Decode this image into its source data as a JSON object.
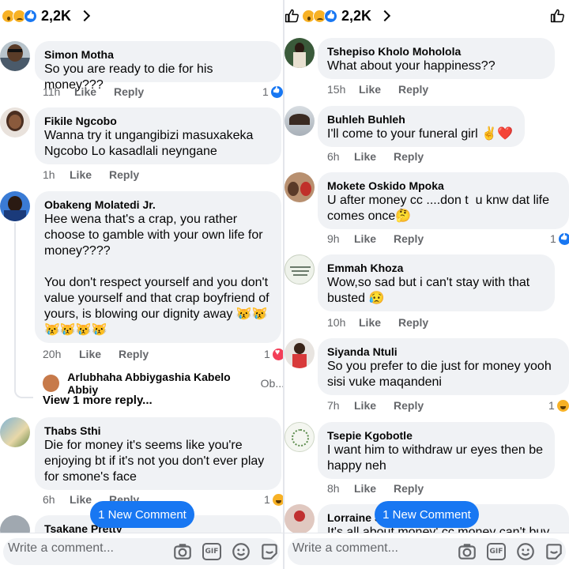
{
  "left": {
    "header": {
      "count": "2,2K"
    },
    "comments": [
      {
        "author": "Simon Motha",
        "text": "So you are ready to die for his money???",
        "time": "11h",
        "like": "Like",
        "reply": "Reply",
        "reaction_count": "1"
      },
      {
        "author": "Fikile Ngcobo",
        "text": "Wanna try it ungangibizi masuxakeka Ngcobo Lo kasadlali neyngane",
        "time": "1h",
        "like": "Like",
        "reply": "Reply"
      },
      {
        "author": "Obakeng Molatedi Jr.",
        "text": "Hee wena that's a crap, you rather choose to gamble with your own life for money????\n\nYou don't respect yourself and you don't value yourself and that crap boyfriend of yours, is blowing our dignity away 😿😿\n😿😿😿😿",
        "time": "20h",
        "like": "Like",
        "reply": "Reply",
        "reaction_count": "1"
      },
      {
        "author": "Thabs Sthi",
        "text": "Die for money it's seems like you're enjoying bt if it's not you don't ever play for smone's face",
        "time": "6h",
        "like": "Like",
        "reply": "Reply",
        "reaction_count": "1"
      },
      {
        "author": "Tsakane Pretty"
      }
    ],
    "reply_preview": {
      "name": "Arlubhaha Abbiygashia Kabelo Abbiy",
      "snippet": "Ob..."
    },
    "view_more": "View 1 more reply...",
    "new_comment": "1 New Comment",
    "composer_placeholder": "Write a comment..."
  },
  "right": {
    "header": {
      "count": "2,2K"
    },
    "comments": [
      {
        "author": "Tshepiso Kholo Moholola",
        "text": "What about your happiness??",
        "time": "15h",
        "like": "Like",
        "reply": "Reply"
      },
      {
        "author": "Buhleh Buhleh",
        "text": "I'll come to your funeral girl ✌️❤️",
        "time": "6h",
        "like": "Like",
        "reply": "Reply"
      },
      {
        "author": "Mokete Oskido Mpoka",
        "text": "U after money cc ....don t  u knw dat life comes once🤔",
        "time": "9h",
        "like": "Like",
        "reply": "Reply",
        "reaction_count": "1"
      },
      {
        "author": "Emmah Khoza",
        "text": "Wow,so sad but i can't stay with that busted 😥",
        "time": "10h",
        "like": "Like",
        "reply": "Reply"
      },
      {
        "author": "Siyanda Ntuli",
        "text": "So you prefer to die just for money yooh sisi vuke maqandeni",
        "time": "7h",
        "like": "Like",
        "reply": "Reply",
        "reaction_count": "1"
      },
      {
        "author": "Tsepie Kgobotle",
        "text": "I want him to withdraw ur eyes then be happy neh",
        "time": "8h",
        "like": "Like",
        "reply": "Reply"
      },
      {
        "author": "Lorraine S",
        "text": "It's all about money' cc money can't buy"
      }
    ],
    "new_comment": "1 New Comment",
    "composer_placeholder": "Write a comment..."
  },
  "icons": [
    "wow-react-icon",
    "sad-react-icon",
    "like-react-icon",
    "chevron-right-icon",
    "thumbs-up-icon",
    "camera-icon",
    "gif-icon",
    "emoji-icon",
    "sticker-icon"
  ],
  "colors": {
    "accent": "#1877f2",
    "bubble": "#f0f2f5",
    "meta": "#65676b"
  }
}
